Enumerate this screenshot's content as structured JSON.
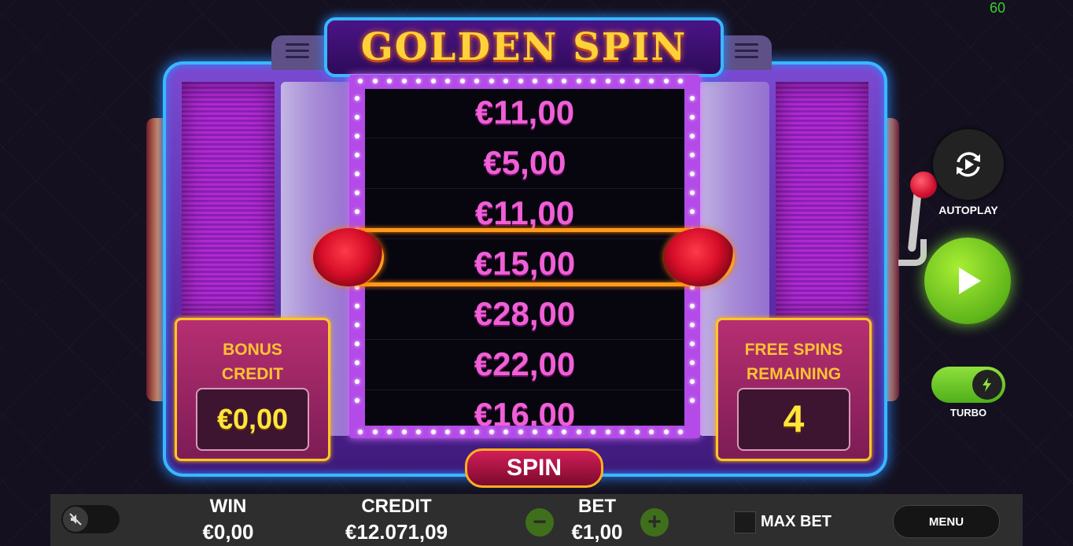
{
  "fps_counter": "60",
  "game": {
    "title": "GOLDEN SPIN",
    "reel_values": [
      "€11,00",
      "€5,00",
      "€11,00",
      "€15,00",
      "€28,00",
      "€22,00",
      "€16,00"
    ],
    "bonus": {
      "label_line1": "BONUS",
      "label_line2": "CREDIT",
      "value": "€0,00"
    },
    "free_spins": {
      "label_line1": "FREE SPINS",
      "label_line2": "REMAINING",
      "value": "4"
    },
    "spin_label": "SPIN"
  },
  "controls": {
    "autoplay_label": "AUTOPLAY",
    "turbo_label": "TURBO",
    "icons": [
      "autoplay-icon",
      "play-icon",
      "lightning-icon",
      "sound-off-icon"
    ]
  },
  "bottom_bar": {
    "win_label": "WIN",
    "win_value": "€0,00",
    "credit_label": "CREDIT",
    "credit_value": "€12.071,09",
    "bet_label": "BET",
    "bet_value": "€1,00",
    "minus_label": "−",
    "plus_label": "+",
    "max_bet_label": "MAX BET",
    "menu_label": "MENU"
  },
  "colors": {
    "accent_gold": "#ffc230",
    "neon_blue": "#3ab8ff",
    "play_green": "#5fb51a",
    "reel_text": "#ef5fd6"
  }
}
